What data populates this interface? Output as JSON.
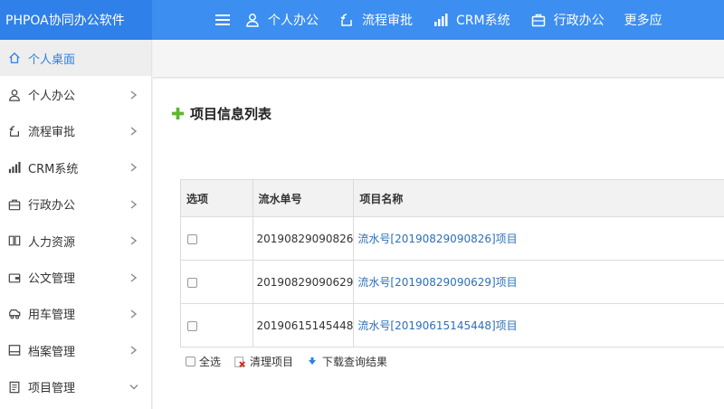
{
  "app": {
    "title": "PHPOA协同办公软件"
  },
  "topnav": [
    {
      "label": "个人办公",
      "icon": "person-icon"
    },
    {
      "label": "流程审批",
      "icon": "flow-icon"
    },
    {
      "label": "CRM系统",
      "icon": "bar-chart-icon"
    },
    {
      "label": "行政办公",
      "icon": "briefcase-icon"
    },
    {
      "label": "更多应",
      "icon": ""
    }
  ],
  "sidebar": {
    "items": [
      {
        "label": "个人桌面",
        "icon": "home-icon",
        "active": true
      },
      {
        "label": "个人办公",
        "icon": "person-icon"
      },
      {
        "label": "流程审批",
        "icon": "flow-icon"
      },
      {
        "label": "CRM系统",
        "icon": "bar-chart-icon"
      },
      {
        "label": "行政办公",
        "icon": "briefcase-icon"
      },
      {
        "label": "人力资源",
        "icon": "book-icon"
      },
      {
        "label": "公文管理",
        "icon": "wallet-icon"
      },
      {
        "label": "用车管理",
        "icon": "car-icon"
      },
      {
        "label": "档案管理",
        "icon": "archive-icon"
      },
      {
        "label": "项目管理",
        "icon": "document-icon",
        "expanded": true
      }
    ]
  },
  "main": {
    "title": "项目信息列表",
    "table": {
      "headers": [
        "选项",
        "流水单号",
        "项目名称"
      ],
      "rows": [
        {
          "serial": "20190829090826",
          "name": "流水号[20190829090826]项目"
        },
        {
          "serial": "20190829090629",
          "name": "流水号[20190829090629]项目"
        },
        {
          "serial": "20190615145448",
          "name": "流水号[20190615145448]项目"
        }
      ]
    },
    "footer": {
      "select_all": "全选",
      "clear": "清理项目",
      "download": "下载查询结果"
    }
  },
  "colors": {
    "topbar": "#3c8ef0",
    "brand_bg": "#2f80e8",
    "link": "#2d6fb8",
    "active_side": "#2d7fe6"
  }
}
